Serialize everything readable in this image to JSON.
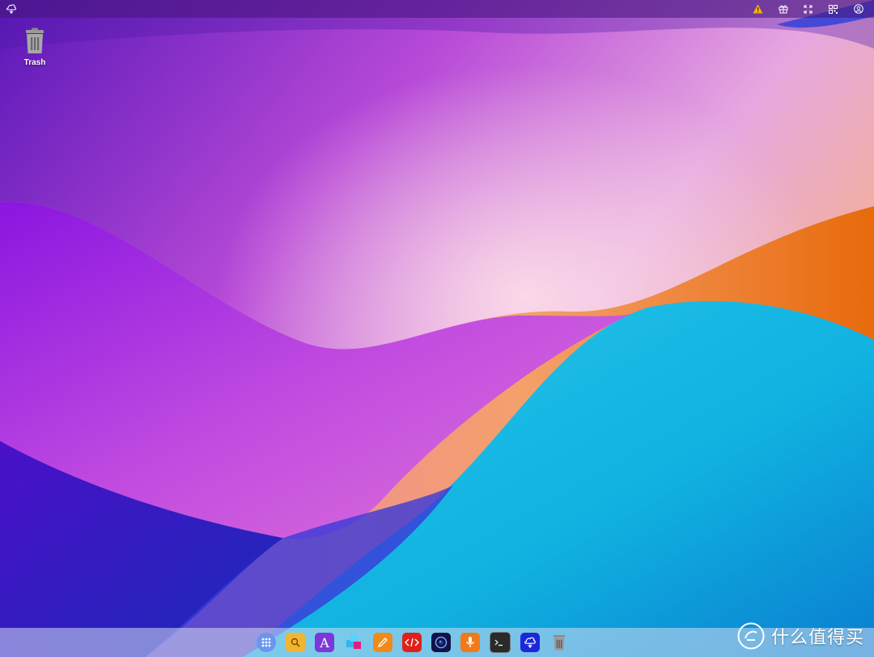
{
  "topbar": {
    "logo_icon": "cloud-tree-logo-icon",
    "tray": [
      {
        "name": "warning-icon",
        "color": "#f5b400"
      },
      {
        "name": "gift-icon"
      },
      {
        "name": "fullscreen-icon"
      },
      {
        "name": "qr-code-icon"
      },
      {
        "name": "user-account-icon"
      }
    ]
  },
  "desktop": {
    "icons": [
      {
        "label": "Trash",
        "icon": "trash-icon"
      }
    ]
  },
  "dock": {
    "apps": [
      {
        "name": "app-launcher-icon",
        "color": "#5b8ff0"
      },
      {
        "name": "file-manager-icon",
        "color": "#f2b531"
      },
      {
        "name": "text-editor-icon",
        "color": "#7a38d8"
      },
      {
        "name": "app-store-icon",
        "color": "#2fb7f0"
      },
      {
        "name": "pencil-tool-icon",
        "color": "#f08a1a"
      },
      {
        "name": "code-editor-icon",
        "color": "#e0201a"
      },
      {
        "name": "camera-icon",
        "color": "#12124a"
      },
      {
        "name": "microphone-icon",
        "color": "#f07a1a"
      },
      {
        "name": "terminal-icon",
        "color": "#2a2a2a"
      },
      {
        "name": "cloud-tree-icon",
        "color": "#1a2ad8"
      },
      {
        "name": "trash-icon",
        "color": "#808080"
      }
    ]
  },
  "watermark": {
    "text": "什么值得买",
    "icon": "smzdm-logo-icon"
  }
}
